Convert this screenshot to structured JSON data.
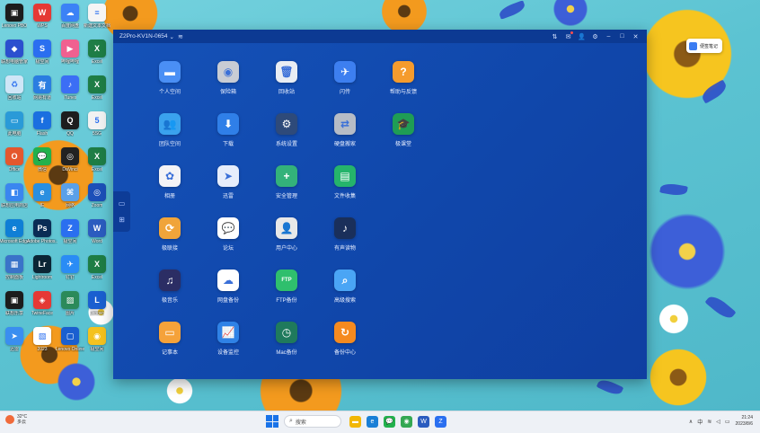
{
  "window": {
    "title": "Z2Pro-KV1N-0654",
    "title_chevron": "⌄",
    "wifi_glyph": "≋",
    "buttons": {
      "settings_sliders": "⇅",
      "messages": "✉",
      "user": "👤",
      "gear": "⚙",
      "minimize": "–",
      "maximize": "□",
      "close": "✕"
    },
    "side_handle": {
      "monitor_icon": "▭",
      "apps_icon": "⊞"
    }
  },
  "apps": [
    {
      "label": "个人空间",
      "icon": "folder-icon",
      "glyph": "▬",
      "color": "#4a8ff5"
    },
    {
      "label": "保险箱",
      "icon": "safe-icon",
      "glyph": "◉",
      "color": "#c8ccd4"
    },
    {
      "label": "回收站",
      "icon": "trash-icon",
      "glyph": "🗑",
      "color": "#e9edf3"
    },
    {
      "label": "闪传",
      "icon": "flash-transfer-icon",
      "glyph": "✈",
      "color": "#3d7ff0"
    },
    {
      "label": "帮助与反馈",
      "icon": "help-icon",
      "glyph": "?",
      "color": "#f59b2d"
    },
    {
      "label": "团队空间",
      "icon": "team-folder-icon",
      "glyph": "👥",
      "color": "#3aa2ee"
    },
    {
      "label": "下载",
      "icon": "download-icon",
      "glyph": "⬇",
      "color": "#2f7fe8"
    },
    {
      "label": "系统设置",
      "icon": "system-settings-icon",
      "glyph": "⚙",
      "color": "#2e4a7a"
    },
    {
      "label": "硬盘搬家",
      "icon": "disk-move-icon",
      "glyph": "⇄",
      "color": "#b6bcc6"
    },
    {
      "label": "极课堂",
      "icon": "classroom-icon",
      "glyph": "🎓",
      "color": "#1f9d55"
    },
    {
      "label": "相册",
      "icon": "photos-icon",
      "glyph": "✿",
      "color": "#f3f3f6"
    },
    {
      "label": "迅雷",
      "icon": "thunder-icon",
      "glyph": "➤",
      "color": "#e6edfb"
    },
    {
      "label": "安全管理",
      "icon": "security-icon",
      "glyph": "+",
      "color": "#33b27a"
    },
    {
      "label": "文件收集",
      "icon": "file-collect-icon",
      "glyph": "▤",
      "color": "#25b46b"
    },
    {
      "label": "极联接",
      "icon": "link-icon",
      "glyph": "⟳",
      "color": "#f0a43a"
    },
    {
      "label": "论坛",
      "icon": "forum-icon",
      "glyph": "💬",
      "color": "#ffffff"
    },
    {
      "label": "用户中心",
      "icon": "user-center-icon",
      "glyph": "👤",
      "color": "#e8e8e8"
    },
    {
      "label": "有声读物",
      "icon": "audiobook-icon",
      "glyph": "♪",
      "color": "#1a2f5a"
    },
    {
      "label": "极音乐",
      "icon": "music-icon",
      "glyph": "♫",
      "color": "#2b2d64"
    },
    {
      "label": "网盘备份",
      "icon": "cloud-backup-icon",
      "glyph": "☁",
      "color": "#ffffff"
    },
    {
      "label": "FTP备份",
      "icon": "ftp-backup-icon",
      "glyph": "FTP",
      "color": "#2fbf6d"
    },
    {
      "label": "高级搜索",
      "icon": "advanced-search-icon",
      "glyph": "⌕",
      "color": "#4aa5f5"
    },
    {
      "label": "记事本",
      "icon": "notepad-icon",
      "glyph": "▭",
      "color": "#f5a23a"
    },
    {
      "label": "设备监控",
      "icon": "device-monitor-icon",
      "glyph": "📈",
      "color": "#2f82e6"
    },
    {
      "label": "Mac备份",
      "icon": "mac-backup-icon",
      "glyph": "◷",
      "color": "#1f7a5c"
    },
    {
      "label": "备份中心",
      "icon": "backup-center-icon",
      "glyph": "↻",
      "color": "#f58a1f"
    }
  ],
  "desktop_icons": [
    {
      "label": "Lenovo PBO",
      "icon": "lenovo-app-icon",
      "color": "#1c1c1c",
      "glyph": "▣"
    },
    {
      "label": "WPS",
      "icon": "wps-icon",
      "color": "#e53935",
      "glyph": "W"
    },
    {
      "label": "百度网盘",
      "icon": "baidu-netdisk-icon",
      "color": "#3b82f6",
      "glyph": "☁"
    },
    {
      "label": "新建文本文档",
      "icon": "text-document-icon",
      "color": "#f5f5f5",
      "glyph": "≡"
    },
    {
      "label": "联想电脑管家",
      "icon": "lenovo-manager-icon",
      "color": "#2b4fcf",
      "glyph": "◆"
    },
    {
      "label": "极空间",
      "icon": "zspace-icon",
      "color": "#2a6ff0",
      "glyph": "S"
    },
    {
      "label": "哔哩哔哩",
      "icon": "bilibili-icon",
      "color": "#f06090",
      "glyph": "▶"
    },
    {
      "label": "Excel",
      "icon": "excel-icon",
      "color": "#1e7d45",
      "glyph": "X"
    },
    {
      "label": "回收站",
      "icon": "recycle-bin-icon",
      "color": "#cfe6f7",
      "glyph": "♻"
    },
    {
      "label": "网易有道",
      "icon": "youdao-icon",
      "color": "#2a7de1",
      "glyph": "有"
    },
    {
      "label": "iTunes",
      "icon": "itunes-icon",
      "color": "#3b6ef5",
      "glyph": "♪"
    },
    {
      "label": "Excel",
      "icon": "excel-icon",
      "color": "#1e7d45",
      "glyph": "X"
    },
    {
      "label": "此电脑",
      "icon": "this-pc-icon",
      "color": "#2a9ad8",
      "glyph": "▭"
    },
    {
      "label": "Flash",
      "icon": "flash-icon",
      "color": "#1a6fe0",
      "glyph": "f"
    },
    {
      "label": "QQ",
      "icon": "qq-icon",
      "color": "#1d1d1d",
      "glyph": "Q"
    },
    {
      "label": "5SG",
      "icon": "5sg-icon",
      "color": "#f2f2f2",
      "glyph": "5"
    },
    {
      "label": "Office",
      "icon": "office-icon",
      "color": "#e4572e",
      "glyph": "O"
    },
    {
      "label": "微信",
      "icon": "wechat-icon",
      "color": "#22b14c",
      "glyph": "💬"
    },
    {
      "label": "DaVinci",
      "icon": "davinci-icon",
      "color": "#222",
      "glyph": "◎"
    },
    {
      "label": "Excel",
      "icon": "excel-icon",
      "color": "#1e7d45",
      "glyph": "X"
    },
    {
      "label": "联想应用商店",
      "icon": "app-store-icon",
      "color": "#3a86f0",
      "glyph": "◧"
    },
    {
      "label": "IE",
      "icon": "ie-icon",
      "color": "#2a8fe0",
      "glyph": "e"
    },
    {
      "label": "网络",
      "icon": "network-icon",
      "color": "#5aa0e8",
      "glyph": "⌘"
    },
    {
      "label": "Zoom",
      "icon": "zoom-icon",
      "color": "#1c4fb8",
      "glyph": "◎"
    },
    {
      "label": "Microsoft Edge",
      "icon": "edge-icon",
      "color": "#0f7fd6",
      "glyph": "e"
    },
    {
      "label": "Adobe Photos...",
      "icon": "photoshop-icon",
      "color": "#0a2c55",
      "glyph": "Ps"
    },
    {
      "label": "极空间",
      "icon": "zspace-icon",
      "color": "#2a6ff0",
      "glyph": "Z"
    },
    {
      "label": "Word",
      "icon": "word-icon",
      "color": "#2b5cbf",
      "glyph": "W"
    },
    {
      "label": "控制面板",
      "icon": "control-panel-icon",
      "color": "#3a73c9",
      "glyph": "▦"
    },
    {
      "label": "Lightroom",
      "icon": "lightroom-icon",
      "color": "#0b2535",
      "glyph": "Lr"
    },
    {
      "label": "钉钉",
      "icon": "dingtalk-icon",
      "color": "#2a8cf5",
      "glyph": "✈"
    },
    {
      "label": "Excel",
      "icon": "excel-icon",
      "color": "#1e7d45",
      "glyph": "X"
    },
    {
      "label": "联想乐享",
      "icon": "lenovo-share-icon",
      "color": "#1c1c1c",
      "glyph": "▣"
    },
    {
      "label": "TwineFace",
      "icon": "twineface-icon",
      "color": "#e53935",
      "glyph": "◈"
    },
    {
      "label": "图片",
      "icon": "picture-icon",
      "color": "#2b8a5a",
      "glyph": "▨"
    },
    {
      "label": "Lenovo",
      "icon": "lenovo-icon",
      "color": "#1a5fd0",
      "glyph": "L"
    },
    {
      "label": "迅雷",
      "icon": "thunder-desktop-icon",
      "color": "#3a8ef0",
      "glyph": "➤"
    },
    {
      "label": "2023",
      "icon": "image-file-icon",
      "color": "#ffffff",
      "glyph": "▧"
    },
    {
      "label": "Lenovo Online",
      "icon": "lenovo-online-icon",
      "color": "#1a5fd0",
      "glyph": "▢"
    },
    {
      "label": "极空间",
      "icon": "zspace-photo-icon",
      "color": "#f4c21e",
      "glyph": "◉"
    }
  ],
  "sticky_note": {
    "label": "便签笔记"
  },
  "taskbar": {
    "weather_temp": "32°C",
    "weather_desc": "多云",
    "search_placeholder": "搜索",
    "search_glyph": "⌕",
    "apps": [
      {
        "name": "file-explorer-icon",
        "color": "#f2b705",
        "glyph": "▬"
      },
      {
        "name": "edge-browser-icon",
        "color": "#1a7fd6",
        "glyph": "e"
      },
      {
        "name": "wechat-taskbar-icon",
        "color": "#22b14c",
        "glyph": "💬"
      },
      {
        "name": "chrome-icon",
        "color": "#34a853",
        "glyph": "◉"
      },
      {
        "name": "word-taskbar-icon",
        "color": "#2b5cbf",
        "glyph": "W"
      },
      {
        "name": "zspace-taskbar-icon",
        "color": "#2a6ff0",
        "glyph": "Z"
      }
    ],
    "tray": {
      "chevron": "∧",
      "ime": "中",
      "wifi": "≋",
      "volume": "◁",
      "battery": "▭"
    },
    "time": "21:24",
    "date": "2023/8/6"
  }
}
